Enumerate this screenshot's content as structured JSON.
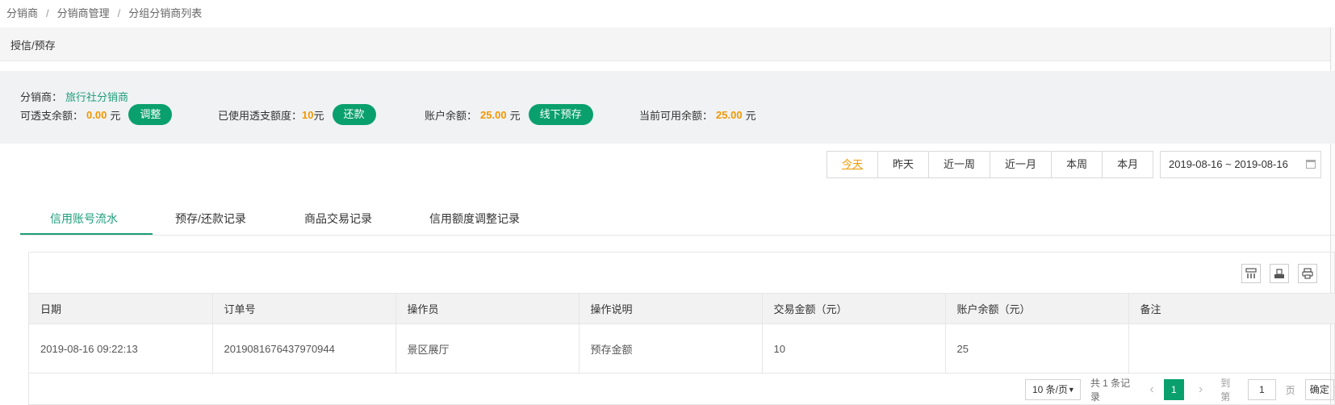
{
  "breadcrumb": [
    "分销商",
    "分销商管理",
    "分组分销商列表"
  ],
  "breadcrumb_sep": "/",
  "section_title": "授信/预存",
  "summary": {
    "distributor_label": "分销商：",
    "distributor_name": "旅行社分销商",
    "overdraft_label": "可透支余额：",
    "overdraft_value": "0.00",
    "overdraft_unit": "元",
    "adjust_button": "调整",
    "used_label": "已使用透支额度：",
    "used_value": "10",
    "used_unit": "元",
    "repay_button": "还款",
    "balance_label": "账户余额：",
    "balance_value": "25.00",
    "balance_unit": "元",
    "offline_button": "线下预存",
    "available_label": "当前可用余额：",
    "available_value": "25.00",
    "available_unit": "元"
  },
  "ranges": [
    "今天",
    "昨天",
    "近一周",
    "近一月",
    "本周",
    "本月"
  ],
  "active_range": "今天",
  "date_range": "2019-08-16 ~ 2019-08-16",
  "tabs": [
    "信用账号流水",
    "预存/还款记录",
    "商品交易记录",
    "信用额度调整记录"
  ],
  "active_tab": "信用账号流水",
  "table": {
    "columns": [
      "日期",
      "订单号",
      "操作员",
      "操作说明",
      "交易金额（元）",
      "账户余额（元）",
      "备注"
    ],
    "rows": [
      [
        "2019-08-16 09:22:13",
        "2019081676437970944",
        "景区展厅",
        "预存金额",
        "10",
        "25",
        ""
      ]
    ]
  },
  "toolbar_icons": [
    "columns-icon",
    "export-icon",
    "print-icon"
  ],
  "pager": {
    "page_size": "10 条/页",
    "total": "共 1 条记录",
    "current_page": "1",
    "goto_label": "到第",
    "goto_value": "1",
    "page_unit": "页",
    "confirm": "确定"
  },
  "colors": {
    "accent": "#0aa06e",
    "link": "#1e9e7a",
    "highlight": "#f39800"
  }
}
